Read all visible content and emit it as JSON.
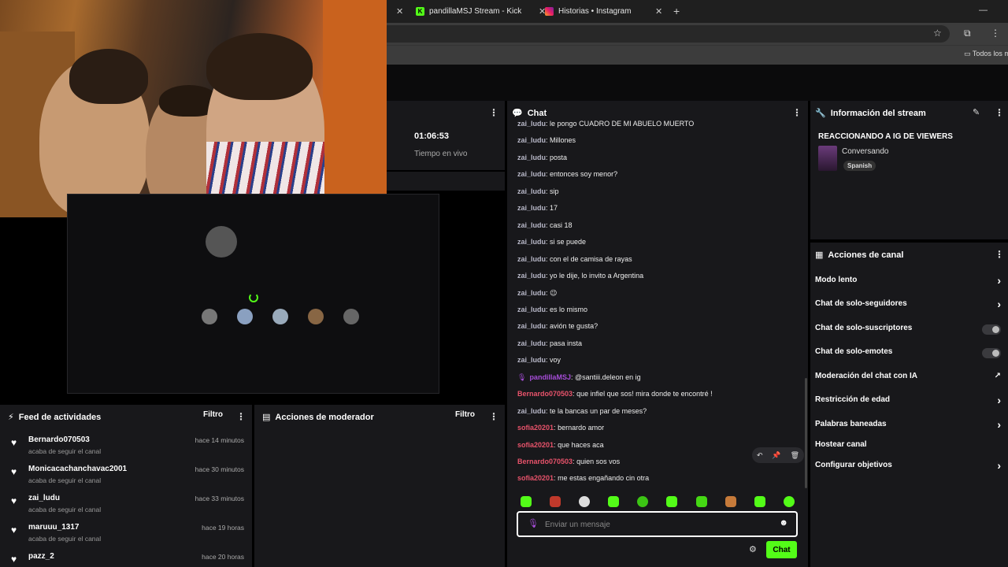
{
  "browser": {
    "tabs": [
      {
        "title": "pandillaMSJ Stream - Kick Dash"
      },
      {
        "title": "Historias • Instagram"
      }
    ],
    "bookmarks_folder": "Todos los m"
  },
  "stream_stats": {
    "uptime": "01:06:53",
    "uptime_label": "Tiempo en vivo"
  },
  "activity_feed": {
    "title": "Feed de actividades",
    "filter_label": "Filtro",
    "items": [
      {
        "user": "Bernardo070503",
        "action": "acaba de seguir el canal",
        "time": "hace 14 minutos"
      },
      {
        "user": "Monicacachanchavac2001",
        "action": "acaba de seguir el canal",
        "time": "hace 30 minutos"
      },
      {
        "user": "zai_ludu",
        "action": "acaba de seguir el canal",
        "time": "hace 33 minutos"
      },
      {
        "user": "maruuu_1317",
        "action": "acaba de seguir el canal",
        "time": "hace 19 horas"
      },
      {
        "user": "pazz_2",
        "action": "",
        "time": "hace 20 horas"
      }
    ]
  },
  "mod_actions": {
    "title": "Acciones de moderador",
    "filter_label": "Filtro"
  },
  "chat": {
    "title": "Chat",
    "messages": [
      {
        "user": "zai_ludu",
        "text": "le pongo CUADRO DE MI ABUELO MUERTO",
        "color": "#b8b8c8"
      },
      {
        "user": "zai_ludu",
        "text": "Millones",
        "color": "#b8b8c8"
      },
      {
        "user": "zai_ludu",
        "text": "posta",
        "color": "#b8b8c8"
      },
      {
        "user": "zai_ludu",
        "text": "entonces soy menor?",
        "color": "#b8b8c8"
      },
      {
        "user": "zai_ludu",
        "text": "sip",
        "color": "#b8b8c8"
      },
      {
        "user": "zai_ludu",
        "text": "17",
        "color": "#b8b8c8"
      },
      {
        "user": "zai_ludu",
        "text": "casi 18",
        "color": "#b8b8c8"
      },
      {
        "user": "zai_ludu",
        "text": "si se puede",
        "color": "#b8b8c8"
      },
      {
        "user": "zai_ludu",
        "text": "con el de camisa de rayas",
        "color": "#b8b8c8"
      },
      {
        "user": "zai_ludu",
        "text": "yo le dije, lo invito a Argentina",
        "color": "#b8b8c8"
      },
      {
        "user": "zai_ludu",
        "text": "😉",
        "color": "#b8b8c8"
      },
      {
        "user": "zai_ludu",
        "text": "es lo mismo",
        "color": "#b8b8c8"
      },
      {
        "user": "zai_ludu",
        "text": "avión te gusta?",
        "color": "#b8b8c8"
      },
      {
        "user": "zai_ludu",
        "text": "pasa insta",
        "color": "#b8b8c8"
      },
      {
        "user": "zai_ludu",
        "text": "voy",
        "color": "#b8b8c8"
      },
      {
        "user": "pandillaMSJ",
        "text": "@santiii.deleon en ig",
        "color": "#a64dd8",
        "badge": "mic-badge"
      },
      {
        "user": "Bernardo070503",
        "text": "que infiel que sos! mira donde te encontré !",
        "color": "#e8536b"
      },
      {
        "user": "zai_ludu",
        "text": "te la bancas un par de meses?",
        "color": "#b8b8c8"
      },
      {
        "user": "sofia20201",
        "text": "bernardo amor",
        "color": "#e8536b"
      },
      {
        "user": "sofia20201",
        "text": "que haces aca",
        "color": "#e8536b"
      },
      {
        "user": "Bernardo070503",
        "text": "quien sos vos",
        "color": "#e8536b"
      },
      {
        "user": "sofia20201",
        "text": "me estas engañando cin otra",
        "color": "#e8536b"
      }
    ],
    "input_placeholder": "Enviar un mensaje",
    "send_label": "Chat"
  },
  "stream_info": {
    "title": "Información del stream",
    "stream_title": "REACCIONANDO A IG DE VIEWERS",
    "category": "Conversando",
    "language": "Spanish"
  },
  "channel_actions": {
    "title": "Acciones de canal",
    "items": [
      {
        "label": "Modo lento",
        "control": "chevron"
      },
      {
        "label": "Chat de solo-seguidores",
        "control": "chevron"
      },
      {
        "label": "Chat de solo-suscriptores",
        "control": "toggle"
      },
      {
        "label": "Chat de solo-emotes",
        "control": "toggle"
      },
      {
        "label": "Moderación del chat con IA",
        "control": "external"
      },
      {
        "label": "Restricción de edad",
        "control": "chevron"
      },
      {
        "label": "Palabras baneadas",
        "control": "chevron"
      },
      {
        "label": "Hostear canal",
        "control": "none"
      },
      {
        "label": "Configurar objetivos",
        "control": "chevron"
      }
    ]
  },
  "colors": {
    "kick_green": "#53fc18",
    "panel_bg": "#18181b"
  }
}
